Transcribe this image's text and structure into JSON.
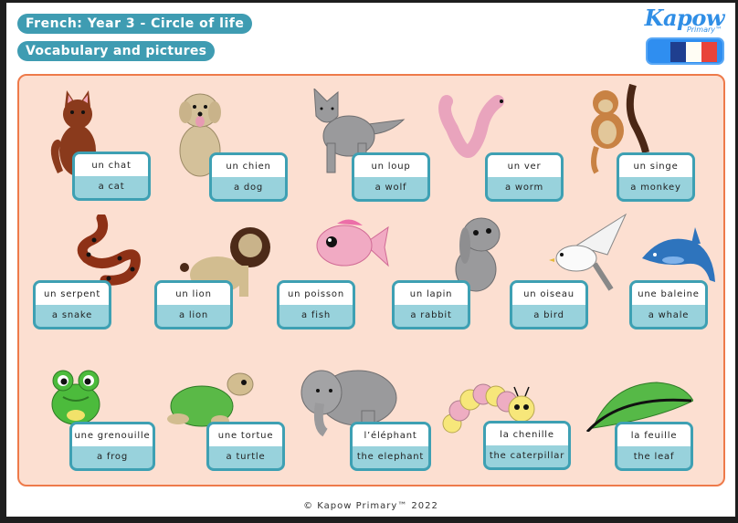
{
  "header": {
    "title": "French: Year 3 - Circle of life",
    "subtitle": "Vocabulary and pictures"
  },
  "logo": {
    "brand": "Kapow",
    "sub": "Primary™"
  },
  "language_button": {
    "icon": "french-flag-icon",
    "flag_colors": [
      "#1f3f8f",
      "#fffdf4",
      "#e8433a"
    ]
  },
  "colors": {
    "accent": "#3f9cb2",
    "panel_bg": "#fcdfd1",
    "panel_border": "#ee7a4a",
    "card_border": "#3ea0b3",
    "card_lower": "#98d2dc",
    "brand_blue": "#2f8ee6"
  },
  "vocabulary": [
    {
      "french": "un chat",
      "english": "a cat",
      "picture": "cat-picture"
    },
    {
      "french": "un chien",
      "english": "a dog",
      "picture": "dog-picture"
    },
    {
      "french": "un loup",
      "english": "a wolf",
      "picture": "wolf-picture"
    },
    {
      "french": "un ver",
      "english": "a worm",
      "picture": "worm-picture"
    },
    {
      "french": "un singe",
      "english": "a monkey",
      "picture": "monkey-picture"
    },
    {
      "french": "un serpent",
      "english": "a snake",
      "picture": "snake-picture"
    },
    {
      "french": "un lion",
      "english": "a lion",
      "picture": "lion-picture"
    },
    {
      "french": "un poisson",
      "english": "a fish",
      "picture": "fish-picture"
    },
    {
      "french": "un lapin",
      "english": "a rabbit",
      "picture": "rabbit-picture"
    },
    {
      "french": "un oiseau",
      "english": "a bird",
      "picture": "bird-picture"
    },
    {
      "french": "une baleine",
      "english": "a whale",
      "picture": "whale-picture"
    },
    {
      "french": "une grenouille",
      "english": "a frog",
      "picture": "frog-picture"
    },
    {
      "french": "une tortue",
      "english": "a turtle",
      "picture": "turtle-picture"
    },
    {
      "french": "l’éléphant",
      "english": "the elephant",
      "picture": "elephant-picture"
    },
    {
      "french": "la chenille",
      "english": "the caterpillar",
      "picture": "caterpillar-picture"
    },
    {
      "french": "la feuille",
      "english": "the leaf",
      "picture": "leaf-picture"
    }
  ],
  "footer": {
    "copyright": "© Kapow Primary™ 2022"
  }
}
